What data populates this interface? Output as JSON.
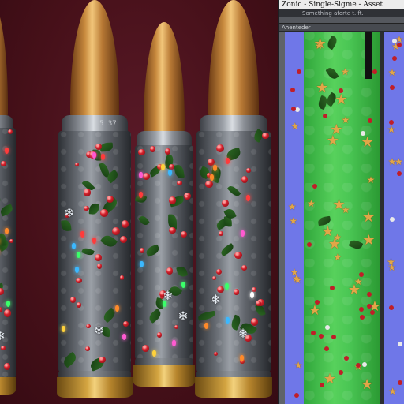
{
  "editor": {
    "title": "Zonic - Single-Sigme - Asset",
    "subtitle": "Something aforte t. ft.",
    "panel_header": "Ahenteder"
  },
  "viewport": {
    "bullet_labels": [
      "5 37"
    ]
  },
  "colors": {
    "background": "#4a1420",
    "casing": "#8c9097",
    "copper_tip": "#c88a3e",
    "brass_base": "#d4a541",
    "texture_green": "#4ac654",
    "texture_blue": "#6f77e8",
    "star_gold": "#e2a648",
    "berry_red": "#d3202b"
  },
  "icons": [
    "snowflake-icon",
    "star-icon",
    "holly-icon",
    "berry-icon",
    "light-bulb-icon"
  ]
}
